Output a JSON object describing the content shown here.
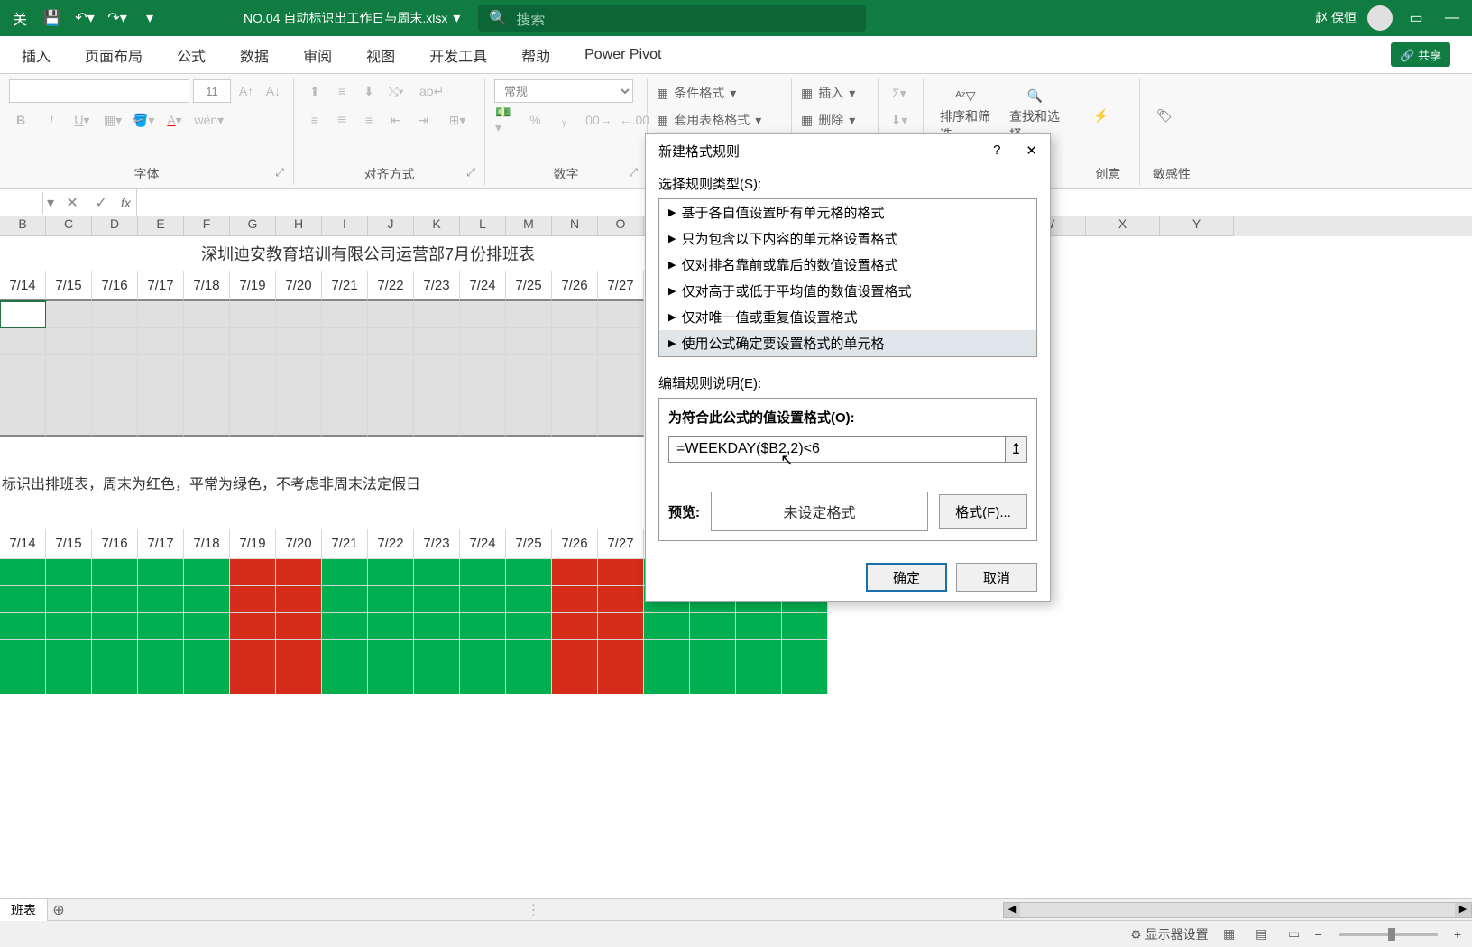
{
  "title_bar": {
    "file_name": "NO.04 自动标识出工作日与周末.xlsx",
    "search_placeholder": "搜索",
    "user_name": "赵 保恒"
  },
  "ribbon_tabs": [
    "插入",
    "页面布局",
    "公式",
    "数据",
    "审阅",
    "视图",
    "开发工具",
    "帮助",
    "Power Pivot"
  ],
  "share_label": "共享",
  "ribbon": {
    "font_size": "11",
    "number_format": "常规",
    "group_font": "字体",
    "group_align": "对齐方式",
    "group_number": "数字",
    "cond_format": "条件格式",
    "table_format": "套用表格格式",
    "insert": "插入",
    "delete": "删除",
    "sort_filter": "排序和筛选",
    "find_select": "查找和选择",
    "creativity": "创意",
    "sensitivity": "敏感性"
  },
  "columns": [
    "B",
    "C",
    "D",
    "E",
    "F",
    "G",
    "H",
    "I",
    "J",
    "K",
    "L",
    "M",
    "N",
    "O",
    "",
    "",
    "",
    "",
    "",
    "",
    "",
    "",
    "W",
    "X",
    "Y"
  ],
  "sheet_title": "深圳迪安教育培训有限公司运营部7月份排班表",
  "dates_upper": [
    "7/14",
    "7/15",
    "7/16",
    "7/17",
    "7/18",
    "7/19",
    "7/20",
    "7/21",
    "7/22",
    "7/23",
    "7/24",
    "7/25",
    "7/26",
    "7/27"
  ],
  "note": "标识出排班表，周末为红色，平常为绿色，不考虑非周末法定假日",
  "dates_lower": [
    "7/14",
    "7/15",
    "7/16",
    "7/17",
    "7/18",
    "7/19",
    "7/20",
    "7/21",
    "7/22",
    "7/23",
    "7/24",
    "7/25",
    "7/26",
    "7/27",
    "",
    "",
    "",
    ""
  ],
  "color_pattern": [
    "g",
    "g",
    "g",
    "g",
    "g",
    "r",
    "r",
    "g",
    "g",
    "g",
    "g",
    "g",
    "r",
    "r",
    "g",
    "g",
    "g",
    "g"
  ],
  "dialog": {
    "title": "新建格式规则",
    "rule_type_label": "选择规则类型(S):",
    "rules": [
      "基于各自值设置所有单元格的格式",
      "只为包含以下内容的单元格设置格式",
      "仅对排名靠前或靠后的数值设置格式",
      "仅对高于或低于平均值的数值设置格式",
      "仅对唯一值或重复值设置格式",
      "使用公式确定要设置格式的单元格"
    ],
    "edit_label": "编辑规则说明(E):",
    "formula_label": "为符合此公式的值设置格式(O):",
    "formula_value": "=WEEKDAY($B2,2)<6",
    "preview_label": "预览:",
    "preview_text": "未设定格式",
    "format_btn": "格式(F)...",
    "ok": "确定",
    "cancel": "取消"
  },
  "sheet_tab": "班表",
  "status": {
    "display_setting": "显示器设置"
  }
}
